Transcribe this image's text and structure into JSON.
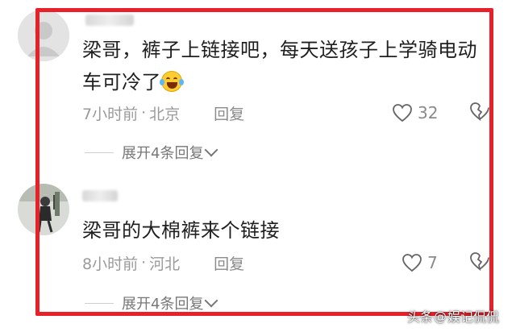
{
  "comments": [
    {
      "avatar": "default-avatar",
      "text_line1": "梁哥，裤子上链接吧，每天送孩子上学骑电动",
      "text_line2": "车可冷了",
      "emoji": "laughing-tears-emoji",
      "time": "7小时前",
      "separator": "·",
      "location": "北京",
      "reply_label": "回复",
      "likes": "32",
      "expand_label": "展开4条回复"
    },
    {
      "avatar": "photo-avatar",
      "text_line1": "梁哥的大棉裤来个链接",
      "time": "8小时前",
      "separator": "·",
      "location": "河北",
      "reply_label": "回复",
      "likes": "7",
      "expand_label": "展开4条回复"
    }
  ],
  "watermark": {
    "prefix": "头条",
    "at": "@",
    "account": "娱记侃侃"
  },
  "colors": {
    "highlight_border": "#e8202a",
    "meta_text": "#9a9a9a"
  }
}
